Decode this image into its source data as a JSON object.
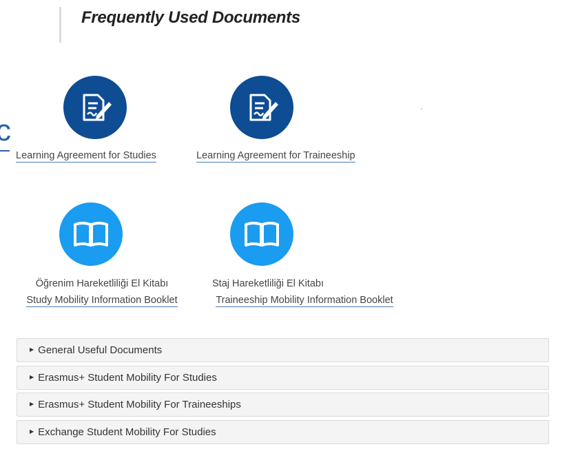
{
  "section_title": "Frequently Used Documents",
  "edge_fragment": "c",
  "documents": [
    {
      "label": "Learning Agreement for Studies",
      "icon": "document-edit-icon"
    },
    {
      "label": "Learning Agreement for Traineeship",
      "icon": "document-edit-icon"
    },
    {
      "label_line1": "Öğrenim Hareketliliği El Kitabı",
      "label_line2": "Study Mobility Information Booklet",
      "icon": "open-book-icon"
    },
    {
      "label_line1": "Staj Hareketliliği El Kitabı",
      "label_line2": "Traineeship Mobility Information Booklet",
      "icon": "open-book-icon"
    }
  ],
  "accordions": [
    {
      "label": "General Useful Documents"
    },
    {
      "label": "Erasmus+ Student Mobility For Studies"
    },
    {
      "label": "Erasmus+ Student Mobility For Traineeships"
    },
    {
      "label": "Exchange Student Mobility For Studies"
    }
  ],
  "colors": {
    "dark_circle": "#0e4c94",
    "light_circle": "#1a9cf0",
    "link_underline": "#4a7dbd"
  }
}
